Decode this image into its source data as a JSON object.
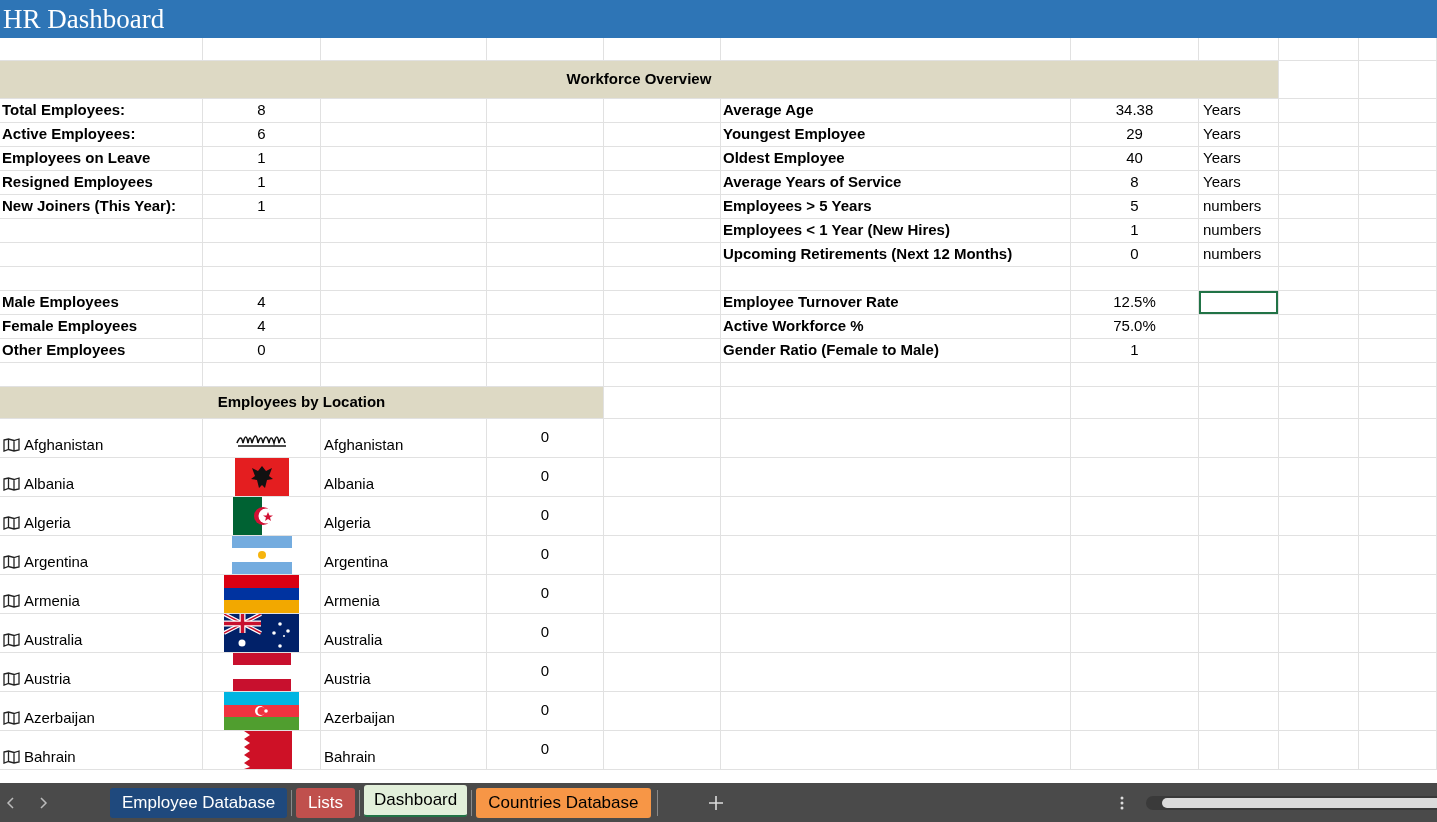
{
  "title": "HR Dashboard",
  "overview": {
    "title": "Workforce Overview",
    "headcount": [
      {
        "label": "Total Employees:",
        "value": "8"
      },
      {
        "label": "Active Employees:",
        "value": "6"
      },
      {
        "label": "Employees on Leave",
        "value": "1"
      },
      {
        "label": "Resigned Employees",
        "value": "1"
      },
      {
        "label": "New Joiners (This Year):",
        "value": "1"
      }
    ],
    "gender": [
      {
        "label": "Male Employees",
        "value": "4"
      },
      {
        "label": "Female Employees",
        "value": "4"
      },
      {
        "label": "Other Employees",
        "value": "0"
      }
    ],
    "tenure": [
      {
        "label": "Average Age",
        "value": "34.38",
        "unit": "Years"
      },
      {
        "label": "Youngest Employee",
        "value": "29",
        "unit": "Years"
      },
      {
        "label": "Oldest Employee",
        "value": "40",
        "unit": "Years"
      },
      {
        "label": "Average Years of Service",
        "value": "8",
        "unit": "Years"
      },
      {
        "label": "Employees > 5 Years",
        "value": "5",
        "unit": "numbers"
      },
      {
        "label": "Employees < 1 Year (New Hires)",
        "value": "1",
        "unit": "numbers"
      },
      {
        "label": "Upcoming Retirements (Next 12 Months)",
        "value": "0",
        "unit": "numbers"
      }
    ],
    "rates": [
      {
        "label": "Employee Turnover Rate",
        "value": "12.5%",
        "selected": true
      },
      {
        "label": "Active Workforce %",
        "value": "75.0%",
        "selected": false
      },
      {
        "label": "Gender Ratio (Female to Male)",
        "value": "1",
        "selected": false
      }
    ]
  },
  "location": {
    "title": "Employees by Location",
    "rows": [
      {
        "country": "Afghanistan",
        "kind": "af",
        "name": "Afghanistan",
        "count": "0"
      },
      {
        "country": "Albania",
        "kind": "al",
        "name": "Albania",
        "count": "0"
      },
      {
        "country": "Algeria",
        "kind": "dz",
        "name": "Algeria",
        "count": "0"
      },
      {
        "country": "Argentina",
        "kind": "ar",
        "name": "Argentina",
        "count": "0"
      },
      {
        "country": "Armenia",
        "kind": "am",
        "name": "Armenia",
        "count": "0"
      },
      {
        "country": "Australia",
        "kind": "au",
        "name": "Australia",
        "count": "0"
      },
      {
        "country": "Austria",
        "kind": "at",
        "name": "Austria",
        "count": "0"
      },
      {
        "country": "Azerbaijan",
        "kind": "az",
        "name": "Azerbaijan",
        "count": "0"
      },
      {
        "country": "Bahrain",
        "kind": "bh",
        "name": "Bahrain",
        "count": "0"
      }
    ]
  },
  "sheet_tabs": [
    {
      "label": "Employee Database",
      "color": "#1f497d",
      "selected": false
    },
    {
      "label": "Lists",
      "color": "#c0504d",
      "selected": false
    },
    {
      "label": "Dashboard",
      "color": "#e2efda",
      "selected": true
    },
    {
      "label": "Countries Database",
      "color": "#f79646",
      "selected": false
    }
  ]
}
